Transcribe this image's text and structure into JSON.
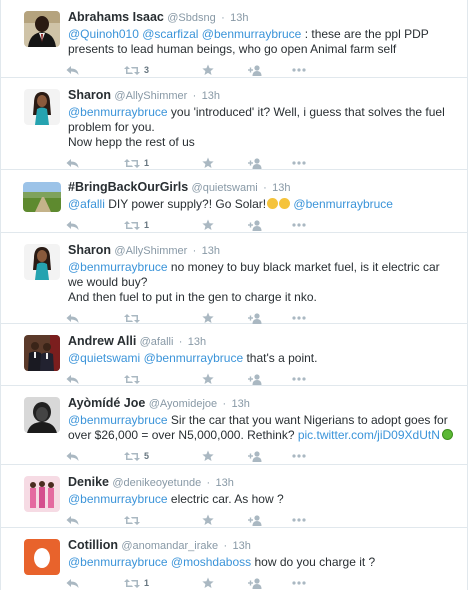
{
  "tweets": [
    {
      "name": "Abrahams Isaac",
      "handle": "@Sbdsng",
      "time": "13h",
      "segments": [
        {
          "t": "mention",
          "v": "@Quinoh010"
        },
        {
          "t": "text",
          "v": " "
        },
        {
          "t": "mention",
          "v": "@scarfizal"
        },
        {
          "t": "text",
          "v": " "
        },
        {
          "t": "mention",
          "v": "@benmurraybruce"
        },
        {
          "t": "text",
          "v": " : these are the ppl PDP presents to lead human beings, who go open Animal farm self"
        }
      ],
      "retweets": "3",
      "avatar": "suit-portrait"
    },
    {
      "name": "Sharon",
      "handle": "@AllyShimmer",
      "time": "13h",
      "segments": [
        {
          "t": "mention",
          "v": "@benmurraybruce"
        },
        {
          "t": "text",
          "v": " you 'introduced' it? Well, i guess that solves the fuel problem for you."
        },
        {
          "t": "br"
        },
        {
          "t": "text",
          "v": "Now hepp the rest of us"
        }
      ],
      "retweets": "1",
      "avatar": "woman-teal"
    },
    {
      "name": "#BringBackOurGirls",
      "handle": "@quietswami",
      "time": "13h",
      "segments": [
        {
          "t": "mention",
          "v": "@afalli"
        },
        {
          "t": "text",
          "v": " DIY power supply?! Go Solar!"
        },
        {
          "t": "emoji"
        },
        {
          "t": "emoji"
        },
        {
          "t": "text",
          "v": " "
        },
        {
          "t": "mention",
          "v": "@benmurraybruce"
        }
      ],
      "retweets": "1",
      "avatar": "field-landscape"
    },
    {
      "name": "Sharon",
      "handle": "@AllyShimmer",
      "time": "13h",
      "segments": [
        {
          "t": "mention",
          "v": "@benmurraybruce"
        },
        {
          "t": "text",
          "v": " no money to buy black market fuel, is it electric car we would buy?"
        },
        {
          "t": "br"
        },
        {
          "t": "text",
          "v": "And then fuel to put in the gen to charge it nko."
        }
      ],
      "retweets": "",
      "avatar": "woman-teal"
    },
    {
      "name": "Andrew Alli",
      "handle": "@afalli",
      "time": "13h",
      "segments": [
        {
          "t": "mention",
          "v": "@quietswami"
        },
        {
          "t": "text",
          "v": " "
        },
        {
          "t": "mention",
          "v": "@benmurraybruce"
        },
        {
          "t": "text",
          "v": " that's a point."
        }
      ],
      "retweets": "",
      "avatar": "two-men"
    },
    {
      "name": "Ayòmídé Joe",
      "handle": "@Ayomidejoe",
      "time": "13h",
      "segments": [
        {
          "t": "mention",
          "v": "@benmurraybruce"
        },
        {
          "t": "text",
          "v": " Sir the car that you want Nigerians to adopt goes for over $26,000 = over N5,000,000. Rethink? "
        },
        {
          "t": "link",
          "v": "pic.twitter.com/jiD09XdUtN"
        },
        {
          "t": "dot"
        }
      ],
      "retweets": "5",
      "avatar": "bw-portrait"
    },
    {
      "name": "Denike",
      "handle": "@denikeoyetunde",
      "time": "13h",
      "segments": [
        {
          "t": "mention",
          "v": "@benmurraybruce"
        },
        {
          "t": "text",
          "v": " electric car. As how ?"
        }
      ],
      "retweets": "",
      "avatar": "pink-group"
    },
    {
      "name": "Cotillion",
      "handle": "@anomandar_irake",
      "time": "13h",
      "segments": [
        {
          "t": "mention",
          "v": "@benmurraybruce"
        },
        {
          "t": "text",
          "v": " "
        },
        {
          "t": "mention",
          "v": "@moshdaboss"
        },
        {
          "t": "text",
          "v": " how do you charge it ?"
        }
      ],
      "retweets": "1",
      "avatar": "orange-egg"
    }
  ],
  "separator": "·",
  "icons": [
    "reply-icon",
    "retweet-icon",
    "favorite-icon",
    "follow-icon",
    "more-icon"
  ],
  "colors": {
    "link": "#3b94d9",
    "meta": "#8899a6",
    "action": "#aab8c2",
    "border": "#e1e8ed"
  }
}
